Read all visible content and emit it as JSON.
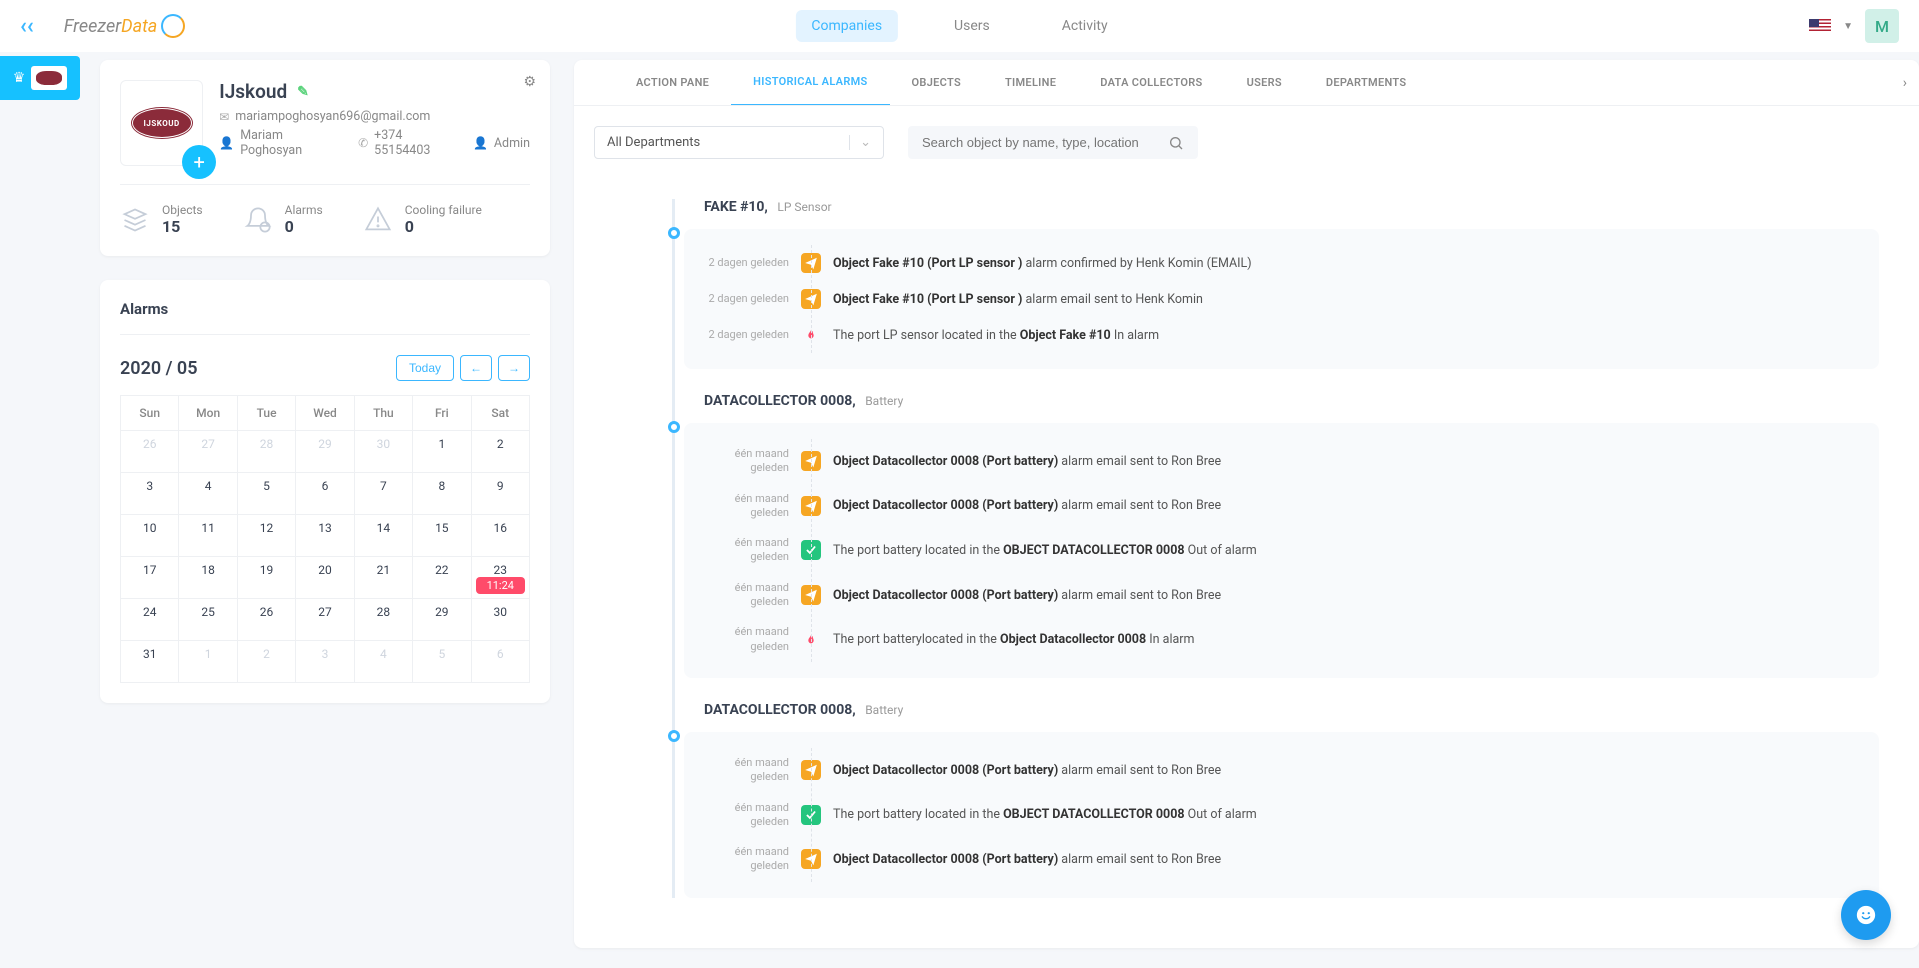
{
  "topbar": {
    "nav": [
      "Companies",
      "Users",
      "Activity"
    ],
    "avatar_initial": "M"
  },
  "company": {
    "name": "IJskoud",
    "logo_text": "IJSKOUD",
    "email": "mariampoghosyan696@gmail.com",
    "contact_name": "Mariam Poghosyan",
    "phone": "+374 55154403",
    "role": "Admin",
    "stats": {
      "objects_label": "Objects",
      "objects_val": "15",
      "alarms_label": "Alarms",
      "alarms_val": "0",
      "cooling_label": "Cooling failure",
      "cooling_val": "0"
    }
  },
  "alarms": {
    "title": "Alarms",
    "cal_title": "2020 / 05",
    "today": "Today",
    "days": [
      "Sun",
      "Mon",
      "Tue",
      "Wed",
      "Thu",
      "Fri",
      "Sat"
    ],
    "weeks": [
      [
        {
          "n": "26",
          "dim": true
        },
        {
          "n": "27",
          "dim": true
        },
        {
          "n": "28",
          "dim": true
        },
        {
          "n": "29",
          "dim": true
        },
        {
          "n": "30",
          "dim": true
        },
        {
          "n": "1"
        },
        {
          "n": "2"
        }
      ],
      [
        {
          "n": "3"
        },
        {
          "n": "4"
        },
        {
          "n": "5"
        },
        {
          "n": "6"
        },
        {
          "n": "7"
        },
        {
          "n": "8"
        },
        {
          "n": "9"
        }
      ],
      [
        {
          "n": "10"
        },
        {
          "n": "11"
        },
        {
          "n": "12"
        },
        {
          "n": "13"
        },
        {
          "n": "14"
        },
        {
          "n": "15"
        },
        {
          "n": "16"
        }
      ],
      [
        {
          "n": "17"
        },
        {
          "n": "18"
        },
        {
          "n": "19"
        },
        {
          "n": "20"
        },
        {
          "n": "21"
        },
        {
          "n": "22"
        },
        {
          "n": "23",
          "badge": "11:24"
        }
      ],
      [
        {
          "n": "24"
        },
        {
          "n": "25"
        },
        {
          "n": "26"
        },
        {
          "n": "27"
        },
        {
          "n": "28"
        },
        {
          "n": "29"
        },
        {
          "n": "30"
        }
      ],
      [
        {
          "n": "31"
        },
        {
          "n": "1",
          "dim": true
        },
        {
          "n": "2",
          "dim": true
        },
        {
          "n": "3",
          "dim": true
        },
        {
          "n": "4",
          "dim": true
        },
        {
          "n": "5",
          "dim": true
        },
        {
          "n": "6",
          "dim": true
        }
      ]
    ]
  },
  "tabs": [
    "ACTION PANE",
    "HISTORICAL ALARMS",
    "OBJECTS",
    "TIMELINE",
    "DATA COLLECTORS",
    "USERS",
    "DEPARTMENTS"
  ],
  "active_tab": 1,
  "filters": {
    "dept": "All Departments",
    "search_ph": "Search object by name, type, location"
  },
  "groups": [
    {
      "title": "FAKE #10,",
      "sub": "LP Sensor",
      "events": [
        {
          "time": "2 dagen geleden",
          "icon": "send",
          "bold": "Object Fake #10 (Port LP sensor )",
          "rest": " alarm confirmed by Henk Komin (EMAIL)"
        },
        {
          "time": "2 dagen geleden",
          "icon": "send",
          "bold": "Object Fake #10 (Port LP sensor )",
          "rest": " alarm email sent to Henk Komin"
        },
        {
          "time": "2 dagen geleden",
          "icon": "fire",
          "pre": "The port LP sensor located in the ",
          "bold": "Object Fake #10",
          "rest": " In alarm"
        }
      ]
    },
    {
      "title": "DATACOLLECTOR  0008,",
      "sub": "Battery",
      "events": [
        {
          "time": "één maand geleden",
          "icon": "send",
          "bold": "Object Datacollector 0008 (Port battery)",
          "rest": " alarm email sent to Ron Bree"
        },
        {
          "time": "één maand geleden",
          "icon": "send",
          "bold": "Object Datacollector 0008 (Port battery)",
          "rest": " alarm email sent to Ron Bree"
        },
        {
          "time": "één maand geleden",
          "icon": "ok",
          "pre": "The port battery located in the ",
          "bold": "OBJECT DATACOLLECTOR 0008",
          "rest": " Out of alarm"
        },
        {
          "time": "één maand geleden",
          "icon": "send",
          "bold": "Object Datacollector 0008 (Port battery)",
          "rest": " alarm email sent to Ron Bree"
        },
        {
          "time": "één maand geleden",
          "icon": "fire",
          "pre": "The port batterylocated in the ",
          "bold": "Object Datacollector 0008",
          "rest": " In alarm"
        }
      ]
    },
    {
      "title": "DATACOLLECTOR  0008,",
      "sub": "Battery",
      "events": [
        {
          "time": "één maand geleden",
          "icon": "send",
          "bold": "Object Datacollector 0008 (Port battery)",
          "rest": " alarm email sent to Ron Bree"
        },
        {
          "time": "één maand geleden",
          "icon": "ok",
          "pre": "The port battery located in the ",
          "bold": "OBJECT DATACOLLECTOR 0008",
          "rest": " Out of alarm"
        },
        {
          "time": "één maand geleden",
          "icon": "send",
          "bold": "Object Datacollector 0008 (Port battery)",
          "rest": " alarm email sent to Ron Bree"
        }
      ]
    }
  ]
}
